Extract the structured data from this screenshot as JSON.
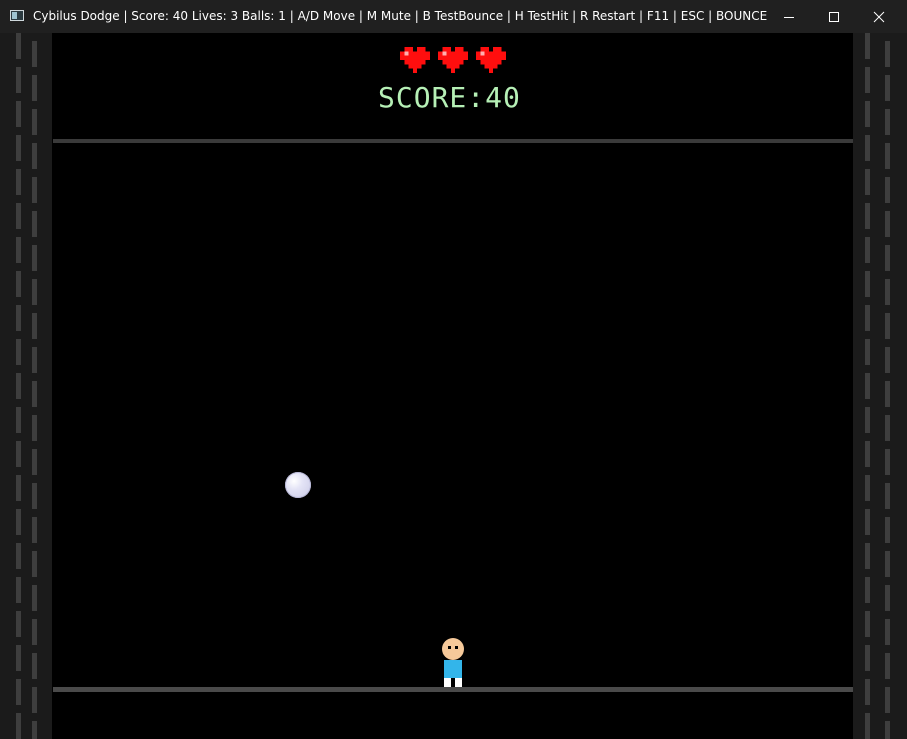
{
  "window": {
    "title": "Cybilus Dodge  |  Score: 40  Lives: 3  Balls: 1  |  A/D Move  |  M Mute  |  B TestBounce  |  H TestHit  |  R Restart  |  F11  |  ESC  |  BOUNCE FIL...",
    "app_icon": "window-app-icon",
    "controls": [
      "minimize-icon",
      "maximize-icon",
      "close-icon"
    ]
  },
  "hud": {
    "lives": 3,
    "heart_color": "#ff0e0e",
    "score_text": "SCORE:40",
    "score_color": "#b6f0b6"
  },
  "game": {
    "balls": 1,
    "ball_color": "#dcdcf2",
    "player_colors": {
      "head": "#f6c99a",
      "torso": "#33b5ea",
      "feet": "#ffffff"
    },
    "wall_color": "#1b1b1b"
  }
}
